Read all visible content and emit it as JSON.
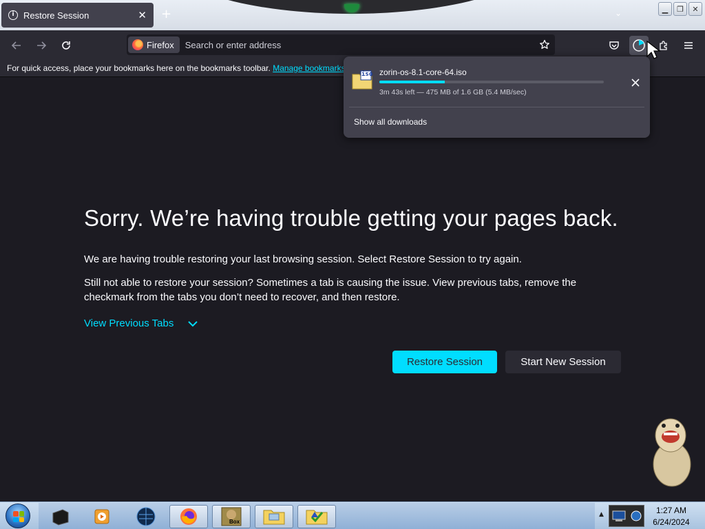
{
  "tab": {
    "title": "Restore Session"
  },
  "nav": {
    "identity_label": "Firefox",
    "url_placeholder": "Search or enter address"
  },
  "bookmarks_bar": {
    "text": "For quick access, place your bookmarks here on the bookmarks toolbar.",
    "link": "Manage bookmarks."
  },
  "content": {
    "heading": "Sorry. We’re having trouble getting your pages back.",
    "p1": "We are having trouble restoring your last browsing session. Select Restore Session to try again.",
    "p2": "Still not able to restore your session? Sometimes a tab is causing the issue. View previous tabs, remove the checkmark from the tabs you don’t need to recover, and then restore.",
    "view_previous_tabs": "View Previous Tabs",
    "restore_button": "Restore Session",
    "new_session_button": "Start New Session"
  },
  "downloads": {
    "file_name": "zorin-os-8.1-core-64.iso",
    "file_type_label": "iso",
    "status": "3m 43s left — 475 MB of 1.6 GB (5.4 MB/sec)",
    "progress": 0.29,
    "show_all": "Show all downloads"
  },
  "taskbar": {
    "time": "1:27 AM",
    "date": "6/24/2024",
    "box_label": "Box"
  },
  "colors": {
    "accent": "#00ddff",
    "page_bg": "#1c1b22",
    "toolbar_bg": "#2b2a33",
    "panel_bg": "#42414d"
  }
}
